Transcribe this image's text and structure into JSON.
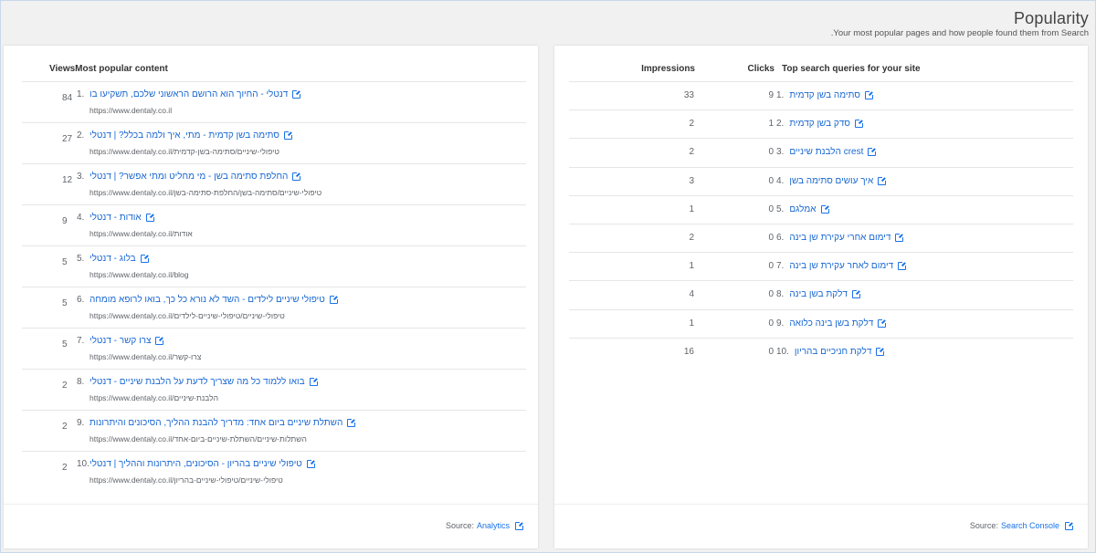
{
  "page": {
    "title": "Popularity",
    "subtitle": ".Your most popular pages and how people found them from Search"
  },
  "popular_content": {
    "header": "ViewsMost popular content",
    "rows": [
      {
        "rank": "1.",
        "views": "84",
        "title": "דנטלי - החיוך הוא הרושם הראשוני שלכם, תשקיעו בו",
        "url": "https://www.dentaly.co.il"
      },
      {
        "rank": "2.",
        "views": "27",
        "title": "סתימה בשן קדמית - מתי, איך ולמה בכלל? | דנטלי",
        "url": "https://www.dentaly.co.il/טיפולי-שיניים/סתימה-בשן-קדמית"
      },
      {
        "rank": "3.",
        "views": "12",
        "title": "החלפת סתימה בשן - מי מחליט ומתי אפשר? | דנטלי",
        "url": "https://www.dentaly.co.il/טיפולי-שיניים/סתימה-בשן/החלפת-סתימה-בשן"
      },
      {
        "rank": "4.",
        "views": "9",
        "title": "אודות - דנטלי",
        "url": "https://www.dentaly.co.il/אודות"
      },
      {
        "rank": "5.",
        "views": "5",
        "title": "בלוג - דנטלי",
        "url": "https://www.dentaly.co.il/blog"
      },
      {
        "rank": "6.",
        "views": "5",
        "title": "טיפולי שיניים לילדים - השד לא נורא כל כך, בואו לרופא מומחה",
        "url": "https://www.dentaly.co.il/טיפולי-שיניים/טיפולי-שיניים-לילדים"
      },
      {
        "rank": "7.",
        "views": "5",
        "title": "צרו קשר - דנטלי",
        "url": "https://www.dentaly.co.il/צרו-קשר"
      },
      {
        "rank": "8.",
        "views": "2",
        "title": "בואו ללמוד כל מה שצריך לדעת על הלבנת שיניים - דנטלי",
        "url": "https://www.dentaly.co.il/הלבנת-שיניים"
      },
      {
        "rank": "9.",
        "views": "2",
        "title": "השתלת שיניים ביום אחד: מדריך להבנת ההליך, הסיכונים והיתרונות",
        "url": "https://www.dentaly.co.il/השתלות-שיניים/השתלת-שיניים-ביום-אחד"
      },
      {
        "rank": "10.",
        "views": "2",
        "title": "טיפולי שיניים בהריון - הסיכונים, היתרונות וההליך | דנטלי",
        "url": "https://www.dentaly.co.il/טיפולי-שיניים/טיפולי-שיניים-בהריון"
      }
    ],
    "source_label": "Source:",
    "source_link": "Analytics"
  },
  "search_queries": {
    "header_impressions": "Impressions",
    "header_clicks": "Clicks",
    "header_queries": "Top search queries for your site",
    "rows": [
      {
        "rank": "1.",
        "clicks": "9",
        "impressions": "33",
        "query": "סתימה בשן קדמית"
      },
      {
        "rank": "2.",
        "clicks": "1",
        "impressions": "2",
        "query": "סדק בשן קדמית"
      },
      {
        "rank": "3.",
        "clicks": "0",
        "impressions": "2",
        "query": "crest הלבנת שיניים"
      },
      {
        "rank": "4.",
        "clicks": "0",
        "impressions": "3",
        "query": "איך עושים סתימה בשן"
      },
      {
        "rank": "5.",
        "clicks": "0",
        "impressions": "1",
        "query": "אמלגם"
      },
      {
        "rank": "6.",
        "clicks": "0",
        "impressions": "2",
        "query": "דימום אחרי עקירת שן בינה"
      },
      {
        "rank": "7.",
        "clicks": "0",
        "impressions": "1",
        "query": "דימום לאחר עקירת שן בינה"
      },
      {
        "rank": "8.",
        "clicks": "0",
        "impressions": "4",
        "query": "דלקת בשן בינה"
      },
      {
        "rank": "9.",
        "clicks": "0",
        "impressions": "1",
        "query": "דלקת בשן בינה כלואה"
      },
      {
        "rank": "10.",
        "clicks": "0",
        "impressions": "16",
        "query": "דלקת חניכיים בהריון"
      }
    ],
    "source_label": "Source:",
    "source_link": "Search Console"
  },
  "icons": {
    "row_link": "external-link-icon",
    "source_link": "external-link-icon"
  },
  "colors": {
    "link": "#1967d2",
    "background": "#f1f1f1",
    "card": "#ffffff"
  }
}
